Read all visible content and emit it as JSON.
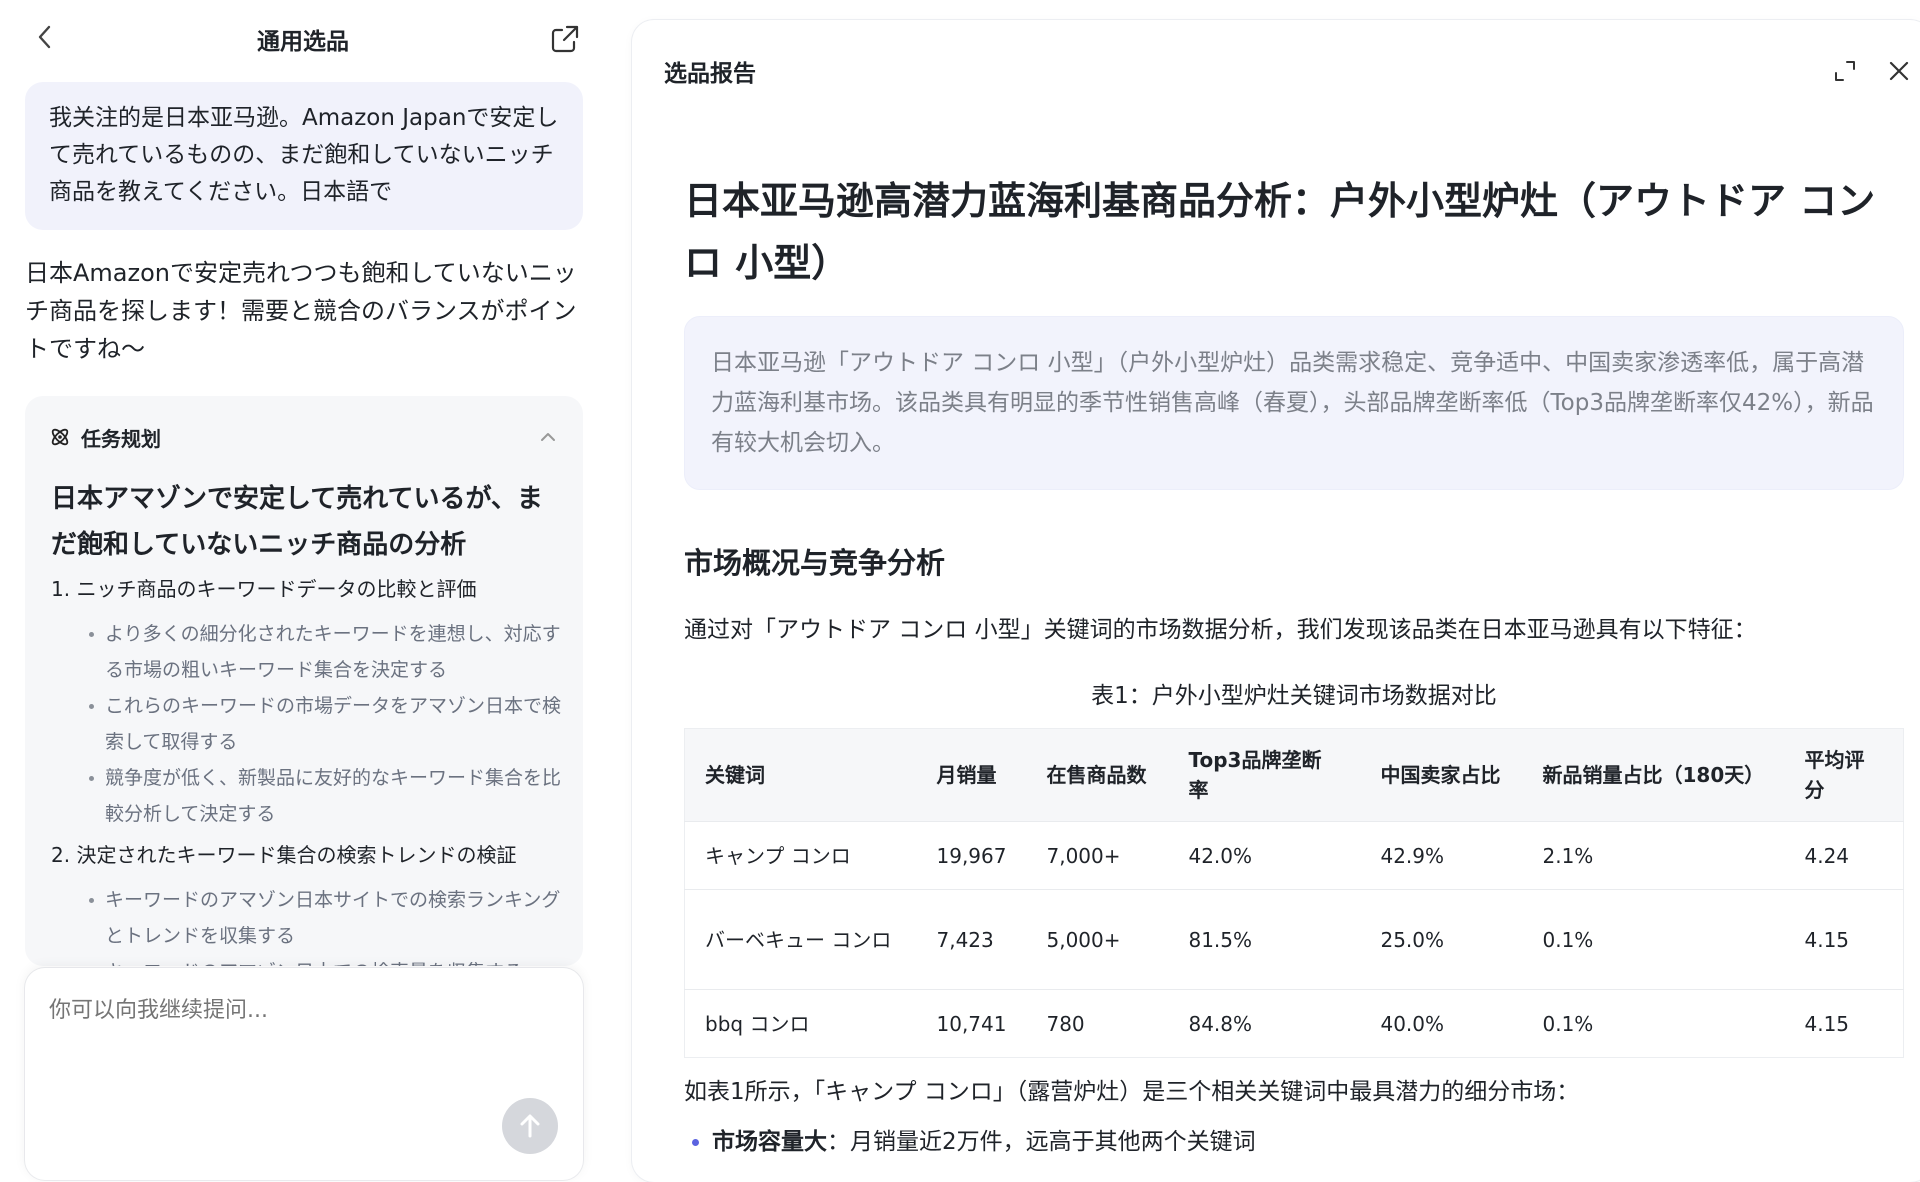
{
  "left_panel": {
    "title": "通用选品",
    "user_message": "我关注的是日本亚马逊。Amazon Japanで安定して売れているものの、まだ飽和していないニッチ商品を教えてください。日本語で",
    "assistant_message": "日本Amazonで安定売れつつも飽和していないニッチ商品を探します！需要と競合のバランスがポイントですね～",
    "task_card": {
      "header": "任务规划",
      "title": "日本アマゾンで安定して売れているが、まだ飽和していないニッチ商品の分析",
      "steps": [
        {
          "label": "1. ニッチ商品のキーワードデータの比較と評価",
          "items": [
            "より多くの細分化されたキーワードを連想し、対応する市場の粗いキーワード集合を決定する",
            "これらのキーワードの市場データをアマゾン日本で検索して取得する",
            "競争度が低く、新製品に友好的なキーワード集合を比較分析して決定する"
          ]
        },
        {
          "label": "2. 決定されたキーワード集合の検索トレンドの検証",
          "items": [
            "キーワードのアマゾン日本サイトでの検索ランキングとトレンドを収集する",
            "キーワードのアマゾン日本での検索量を収集する"
          ]
        }
      ]
    },
    "input": {
      "placeholder": "你可以向我继续提问..."
    }
  },
  "right_panel": {
    "title": "选品报告",
    "report_title": "日本亚马逊高潜力蓝海利基商品分析：户外小型炉灶（アウトドア コンロ 小型）",
    "summary": "日本亚马逊「アウトドア コンロ 小型」（户外小型炉灶）品类需求稳定、竞争适中、中国卖家渗透率低，属于高潜力蓝海利基市场。该品类具有明显的季节性销售高峰（春夏），头部品牌垄断率低（Top3品牌垄断率仅42%），新品有较大机会切入。",
    "section_heading": "市场概况与竞争分析",
    "intro_paragraph": "通过对「アウトドア コンロ 小型」关键词的市场数据分析，我们发现该品类在日本亚马逊具有以下特征：",
    "table_caption": "表1：户外小型炉灶关键词市场数据对比",
    "table": {
      "headers": [
        "关键词",
        "月销量",
        "在售商品数",
        "Top3品牌垄断率",
        "中国卖家占比",
        "新品销量占比（180天）",
        "平均评分"
      ],
      "rows": [
        [
          "キャンプ コンロ",
          "19,967",
          "7,000+",
          "42.0%",
          "42.9%",
          "2.1%",
          "4.24"
        ],
        [
          "バーベキュー コンロ",
          "7,423",
          "5,000+",
          "81.5%",
          "25.0%",
          "0.1%",
          "4.15"
        ],
        [
          "bbq コンロ",
          "10,741",
          "780",
          "84.8%",
          "40.0%",
          "0.1%",
          "4.15"
        ]
      ]
    },
    "after_table": "如表1所示，「キャンプ コンロ」（露营炉灶）是三个相关关键词中最具潜力的细分市场：",
    "bullet": {
      "bold": "市场容量大",
      "text": "：月销量近2万件，远高于其他两个关键词"
    }
  },
  "colors": {
    "user_bubble": "#f1f2fb",
    "summary_bg": "#f2f3fc",
    "bullet_accent": "#5b63e0",
    "send_button": "#d5d7dc"
  }
}
